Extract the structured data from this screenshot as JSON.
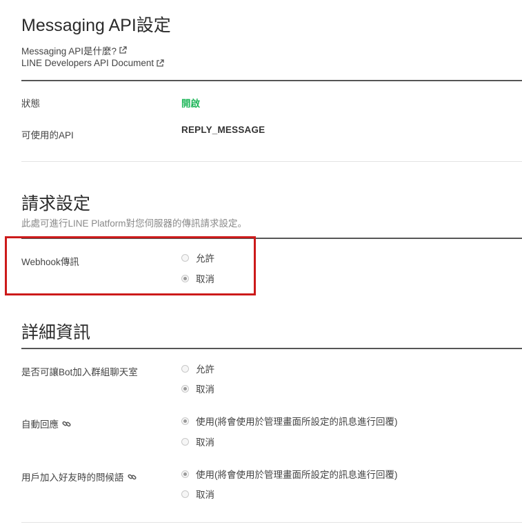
{
  "title": "Messaging API設定",
  "links": {
    "what_is": "Messaging API是什麼?",
    "api_doc": "LINE Developers API Document"
  },
  "status": {
    "label": "狀態",
    "value": "開啟"
  },
  "available_api": {
    "label": "可使用的API",
    "value": "REPLY_MESSAGE"
  },
  "request_settings": {
    "title": "請求設定",
    "subtitle": "此處可進行LINE Platform對您伺服器的傳訊請求設定。",
    "webhook": {
      "label": "Webhook傳訊",
      "options": [
        "允許",
        "取消"
      ],
      "selected": "取消"
    }
  },
  "details": {
    "title": "詳細資訊",
    "group_join": {
      "label": "是否可讓Bot加入群組聊天室",
      "options": [
        "允許",
        "取消"
      ],
      "selected": "取消"
    },
    "auto_reply": {
      "label": "自動回應",
      "options": [
        "使用(將會使用於管理畫面所設定的訊息進行回覆)",
        "取消"
      ],
      "selected": "使用(將會使用於管理畫面所設定的訊息進行回覆)"
    },
    "greeting": {
      "label": "用戶加入好友時的問候語",
      "options": [
        "使用(將會使用於管理畫面所設定的訊息進行回覆)",
        "取消"
      ],
      "selected": "使用(將會使用於管理畫面所設定的訊息進行回覆)"
    }
  },
  "icons": {
    "external": "external-link-icon",
    "chain": "link-chain-icon"
  },
  "colors": {
    "status_on": "#1fb65a",
    "highlight": "#cc1a1a"
  }
}
